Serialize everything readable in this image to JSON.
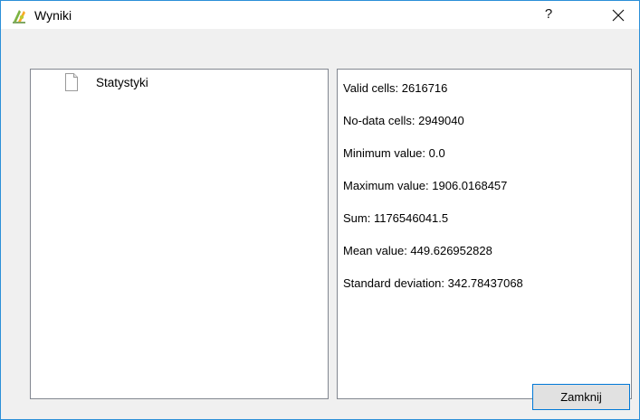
{
  "window": {
    "title": "Wyniki",
    "help_symbol": "?",
    "close_symbol": "✕"
  },
  "tree": {
    "items": [
      {
        "label": "Statystyki",
        "icon": "document-icon"
      }
    ]
  },
  "stats": {
    "lines": [
      "Valid cells: 2616716",
      "No-data cells: 2949040",
      "Minimum value: 0.0",
      "Maximum value: 1906.0168457",
      "Sum: 1176546041.5",
      "Mean value: 449.626952828",
      "Standard deviation: 342.78437068"
    ]
  },
  "buttons": {
    "close_label": "Zamknij"
  },
  "colors": {
    "accent": "#0078d7",
    "window_border": "#2b8fd8",
    "panel_border": "#828790",
    "dialog_bg": "#f0f0f0"
  }
}
